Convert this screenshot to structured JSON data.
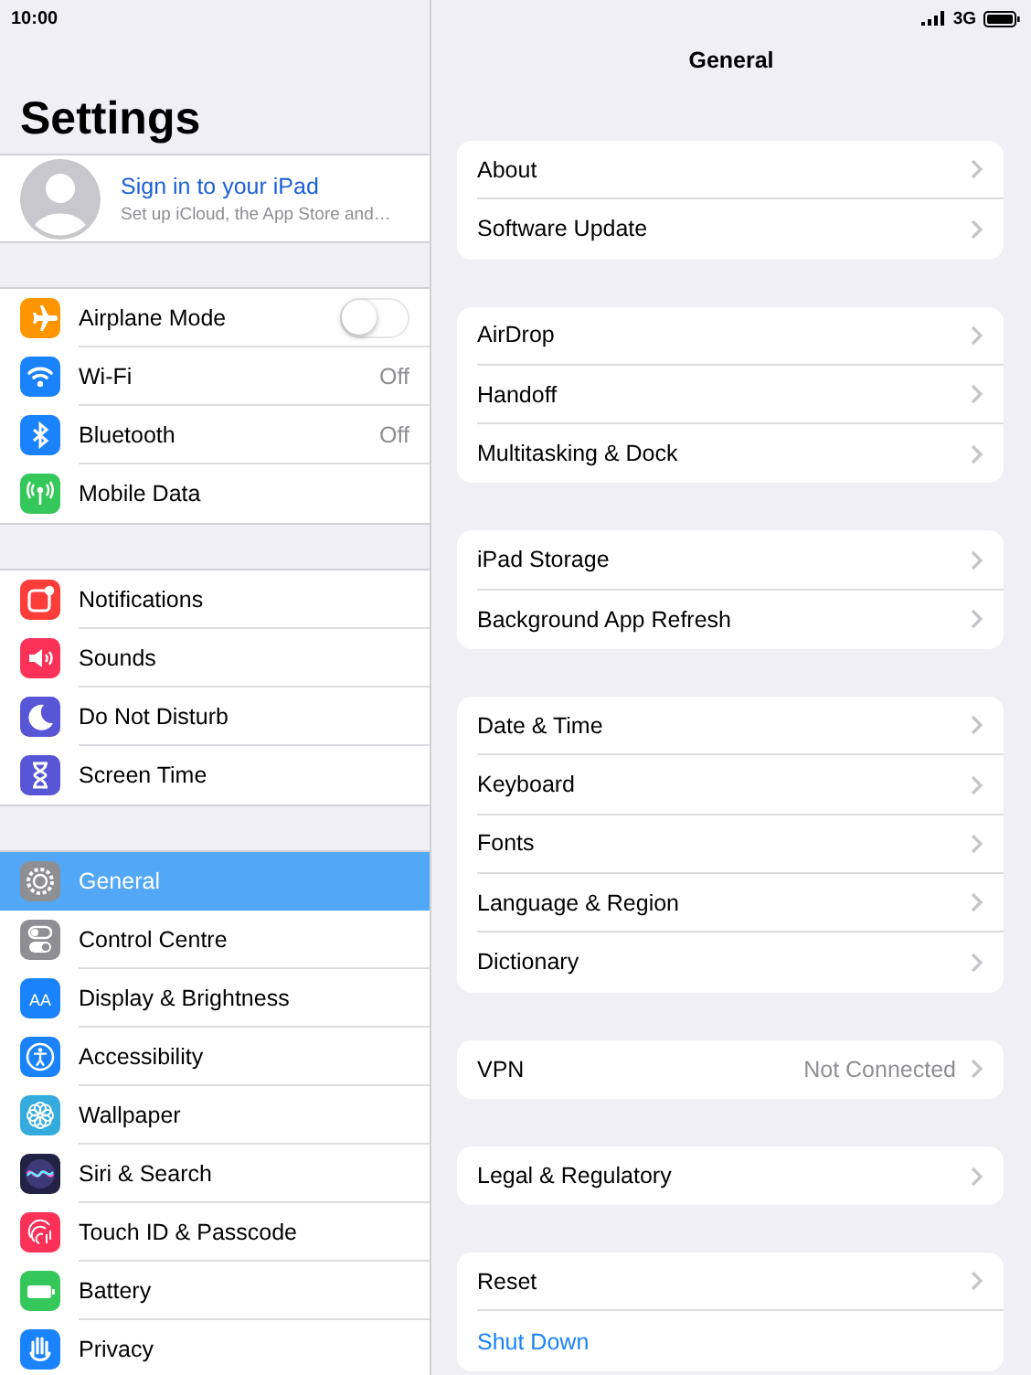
{
  "status_bar": {
    "time": "10:00",
    "network": "3G"
  },
  "sidebar": {
    "title": "Settings",
    "account": {
      "name": "Sign in to your iPad",
      "subtitle": "Set up iCloud, the App Store and…"
    },
    "groups": [
      [
        {
          "label": "Airplane Mode",
          "color": "#ff9500",
          "kind": "toggle",
          "on": false,
          "selected": false
        },
        {
          "label": "Wi-Fi",
          "color": "#1a82fb",
          "kind": "value",
          "value": "Off",
          "selected": false
        },
        {
          "label": "Bluetooth",
          "color": "#1a82fb",
          "kind": "value",
          "value": "Off",
          "selected": false
        },
        {
          "label": "Mobile Data",
          "color": "#34c759",
          "kind": "link",
          "selected": false
        }
      ],
      [
        {
          "label": "Notifications",
          "color": "#fc3d39",
          "kind": "link",
          "selected": false
        },
        {
          "label": "Sounds",
          "color": "#fc3158",
          "kind": "link",
          "selected": false
        },
        {
          "label": "Do Not Disturb",
          "color": "#5856d6",
          "kind": "link",
          "selected": false
        },
        {
          "label": "Screen Time",
          "color": "#5856d6",
          "kind": "link",
          "selected": false
        }
      ],
      [
        {
          "label": "General",
          "color": "#8e8e93",
          "kind": "link",
          "selected": true
        },
        {
          "label": "Control Centre",
          "color": "#8e8e93",
          "kind": "link",
          "selected": false
        },
        {
          "label": "Display & Brightness",
          "glyph": "AA",
          "color": "#1a82fb",
          "kind": "link",
          "selected": false
        },
        {
          "label": "Accessibility",
          "color": "#1a82fb",
          "kind": "link",
          "selected": false
        },
        {
          "label": "Wallpaper",
          "color": "#35aadc",
          "kind": "link",
          "selected": false
        },
        {
          "label": "Siri & Search",
          "color": "#222244",
          "kind": "link",
          "selected": false
        },
        {
          "label": "Touch ID & Passcode",
          "color": "#fc3158",
          "kind": "link",
          "selected": false
        },
        {
          "label": "Battery",
          "color": "#34c759",
          "kind": "link",
          "selected": false
        },
        {
          "label": "Privacy",
          "color": "#1a82fb",
          "kind": "link",
          "selected": false
        }
      ]
    ]
  },
  "detail": {
    "title": "General",
    "groups": [
      [
        {
          "label": "About",
          "kind": "link"
        },
        {
          "label": "Software Update",
          "kind": "link"
        }
      ],
      [
        {
          "label": "AirDrop",
          "kind": "link"
        },
        {
          "label": "Handoff",
          "kind": "link"
        },
        {
          "label": "Multitasking & Dock",
          "kind": "link"
        }
      ],
      [
        {
          "label": "iPad Storage",
          "kind": "link"
        },
        {
          "label": "Background App Refresh",
          "kind": "link"
        }
      ],
      [
        {
          "label": "Date & Time",
          "kind": "link"
        },
        {
          "label": "Keyboard",
          "kind": "link"
        },
        {
          "label": "Fonts",
          "kind": "link"
        },
        {
          "label": "Language & Region",
          "kind": "link"
        },
        {
          "label": "Dictionary",
          "kind": "link"
        }
      ],
      [
        {
          "label": "VPN",
          "kind": "value",
          "value": "Not Connected"
        }
      ],
      [
        {
          "label": "Legal & Regulatory",
          "kind": "link"
        }
      ],
      [
        {
          "label": "Reset",
          "kind": "link"
        },
        {
          "label": "Shut Down",
          "kind": "action"
        }
      ]
    ]
  }
}
